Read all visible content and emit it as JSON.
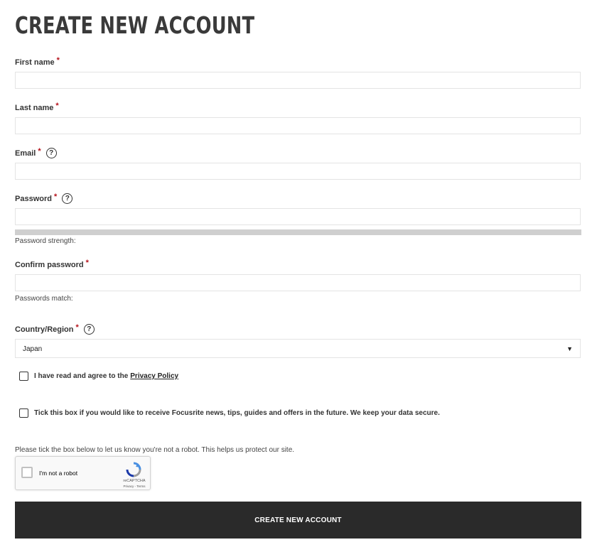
{
  "page": {
    "title": "CREATE NEW ACCOUNT"
  },
  "form": {
    "first_name": {
      "label": "First name",
      "required_mark": "*",
      "value": "",
      "placeholder": ""
    },
    "last_name": {
      "label": "Last name",
      "required_mark": "*",
      "value": "",
      "placeholder": ""
    },
    "email": {
      "label": "Email",
      "required_mark": "*",
      "help": "?",
      "value": "",
      "placeholder": ""
    },
    "password": {
      "label": "Password",
      "required_mark": "*",
      "help": "?",
      "value": "",
      "placeholder": "",
      "strength_text": "Password strength:",
      "strength_level": 0
    },
    "confirm_password": {
      "label": "Confirm password",
      "required_mark": "*",
      "value": "",
      "placeholder": "",
      "match_text": "Passwords match:"
    },
    "country": {
      "label": "Country/Region",
      "required_mark": "*",
      "help": "?",
      "selected": "Japan",
      "arrow": "▼"
    },
    "privacy": {
      "text": "I have read and agree to the",
      "link_text": "Privacy Policy",
      "checked": false
    },
    "newsletter": {
      "text": "Tick this box if you would like to receive Focusrite news, tips, guides and offers in the future. We keep your data secure.",
      "checked": false
    },
    "robot_prompt": "Please tick the box below to let us know you're not a robot. This helps us protect our site.",
    "recaptcha": {
      "label": "I'm not a robot",
      "brand": "reCAPTCHA",
      "terms": "Privacy - Terms",
      "checked": false
    },
    "submit_label": "CREATE NEW ACCOUNT"
  },
  "colors": {
    "required": "#b5121b",
    "button_bg": "#2a2a2a",
    "button_text": "#ffffff",
    "strength_bar": "#cfcfcf"
  }
}
